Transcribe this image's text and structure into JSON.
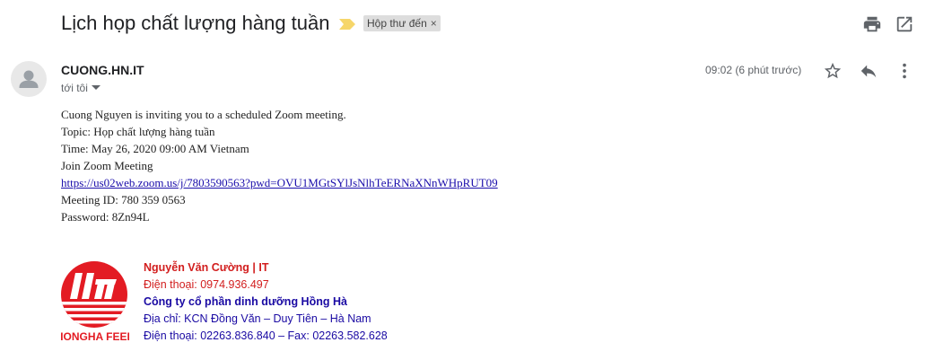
{
  "email": {
    "subject": "Lịch họp chất lượng hàng tuần",
    "label": "Hộp thư đến",
    "label_close": "×",
    "sender": "CUONG.HN.IT",
    "recipient": "tới tôi",
    "time": "09:02 (6 phút trước)",
    "body": {
      "line1": "Cuong Nguyen is inviting you to a scheduled Zoom meeting.",
      "line2": "Topic: Họp chất lượng hàng tuần",
      "line3": "Time: May 26, 2020 09:00 AM Vietnam",
      "line4": "Join Zoom Meeting",
      "link": "https://us02web.zoom.us/j/7803590563?pwd=OVU1MGtSYlJsNlhTeERNaXNnWHpRUT09",
      "line6": "Meeting ID: 780 359 0563",
      "line7": "Password: 8Zn94L"
    },
    "signature": {
      "name": "Nguyễn Văn Cường | IT",
      "phone": "Điện thoại: 0974.936.497",
      "company": "Công ty cổ phần dinh dưỡng Hồng Hà",
      "address": "Địa chỉ: KCN Đồng Văn – Duy Tiên – Hà Nam",
      "phone_fax": "Điện thoại: 02263.836.840 – Fax: 02263.582.628",
      "logo_text": "HONGHA FEED"
    }
  },
  "icons": {
    "print": "print-icon",
    "new_window": "open-in-new-window-icon",
    "star": "star-icon",
    "reply": "reply-icon",
    "more": "more-vert-icon",
    "importance": "importance-marker-icon",
    "avatar": "avatar-icon",
    "dropdown": "caret-down-icon"
  },
  "colors": {
    "signature_red": "#d21e1e",
    "signature_blue": "#1a0aa3",
    "importance_yellow": "#f6d66a",
    "logo_red": "#e31b23"
  }
}
